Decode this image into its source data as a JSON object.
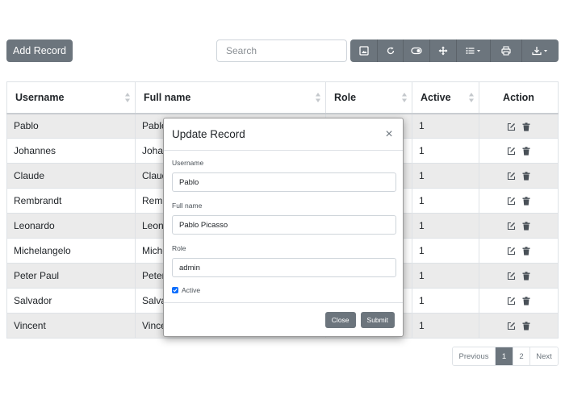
{
  "toolbar": {
    "add_label": "Add Record",
    "search_placeholder": "Search",
    "icons": [
      "image-icon",
      "refresh-icon",
      "toggle-icon",
      "fullscreen-icon",
      "columns-icon",
      "print-icon",
      "export-icon"
    ]
  },
  "table": {
    "headers": [
      "Username",
      "Full name",
      "Role",
      "Active",
      "Action"
    ],
    "rows": [
      {
        "username": "Pablo",
        "fullname": "Pablo",
        "active": "1"
      },
      {
        "username": "Johannes",
        "fullname": "Johan",
        "active": "1"
      },
      {
        "username": "Claude",
        "fullname": "Claud",
        "active": "1"
      },
      {
        "username": "Rembrandt",
        "fullname": "Remb",
        "active": "1"
      },
      {
        "username": "Leonardo",
        "fullname": "Leona",
        "active": "1"
      },
      {
        "username": "Michelangelo",
        "fullname": "Miche",
        "active": "1"
      },
      {
        "username": "Peter Paul",
        "fullname": "Peter",
        "active": "1"
      },
      {
        "username": "Salvador",
        "fullname": "Salva",
        "active": "1"
      },
      {
        "username": "Vincent",
        "fullname": "Vince",
        "active": "1"
      }
    ]
  },
  "modal": {
    "title": "Update Record",
    "close_symbol": "×",
    "username_label": "Username",
    "username_value": "Pablo",
    "fullname_label": "Full name",
    "fullname_value": "Pablo Picasso",
    "role_label": "Role",
    "role_value": "admin",
    "active_label": "Active",
    "active_checked": true,
    "close_button": "Close",
    "submit_button": "Submit"
  },
  "pagination": {
    "previous": "Previous",
    "pages": [
      "1",
      "2"
    ],
    "current": "1",
    "next": "Next"
  },
  "colors": {
    "secondary": "#6c757d",
    "checkbox": "#0d6efd",
    "stripe": "#ebebeb"
  }
}
